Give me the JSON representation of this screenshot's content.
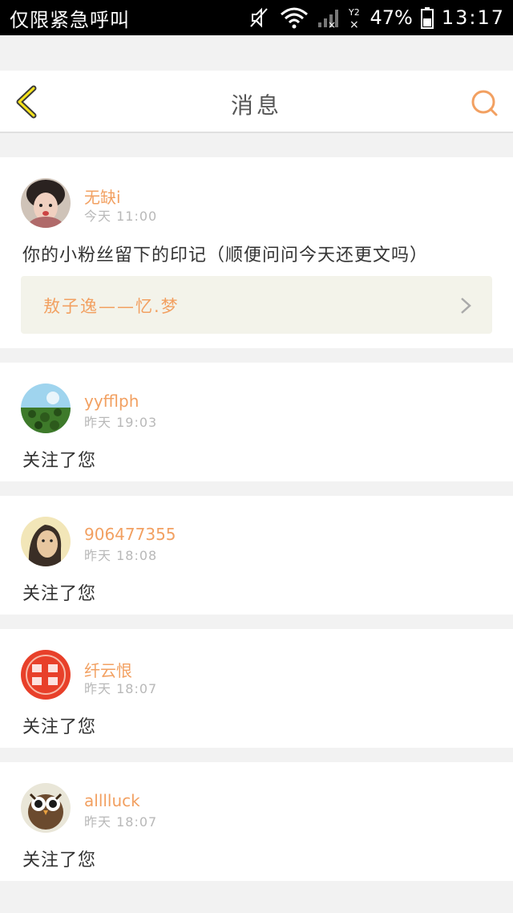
{
  "status_bar": {
    "carrier": "仅限紧急呼叫",
    "battery": "47%",
    "time": "13:17"
  },
  "header": {
    "title": "消息",
    "accent_color": "#f2a061"
  },
  "messages": [
    {
      "username": "无缺i",
      "time": "今天 11:00",
      "text": "你的小粉丝留下的印记（顺便问问今天还更文吗）",
      "quote": "敖子逸——忆.梦"
    },
    {
      "username": "yyfflph",
      "time": "昨天 19:03",
      "text": "关注了您"
    },
    {
      "username": "906477355",
      "time": "昨天 18:08",
      "text": "关注了您"
    },
    {
      "username": "纤云恨",
      "time": "昨天 18:07",
      "text": "关注了您"
    },
    {
      "username": "alllluck",
      "time": "昨天 18:07",
      "text": "关注了您"
    }
  ]
}
